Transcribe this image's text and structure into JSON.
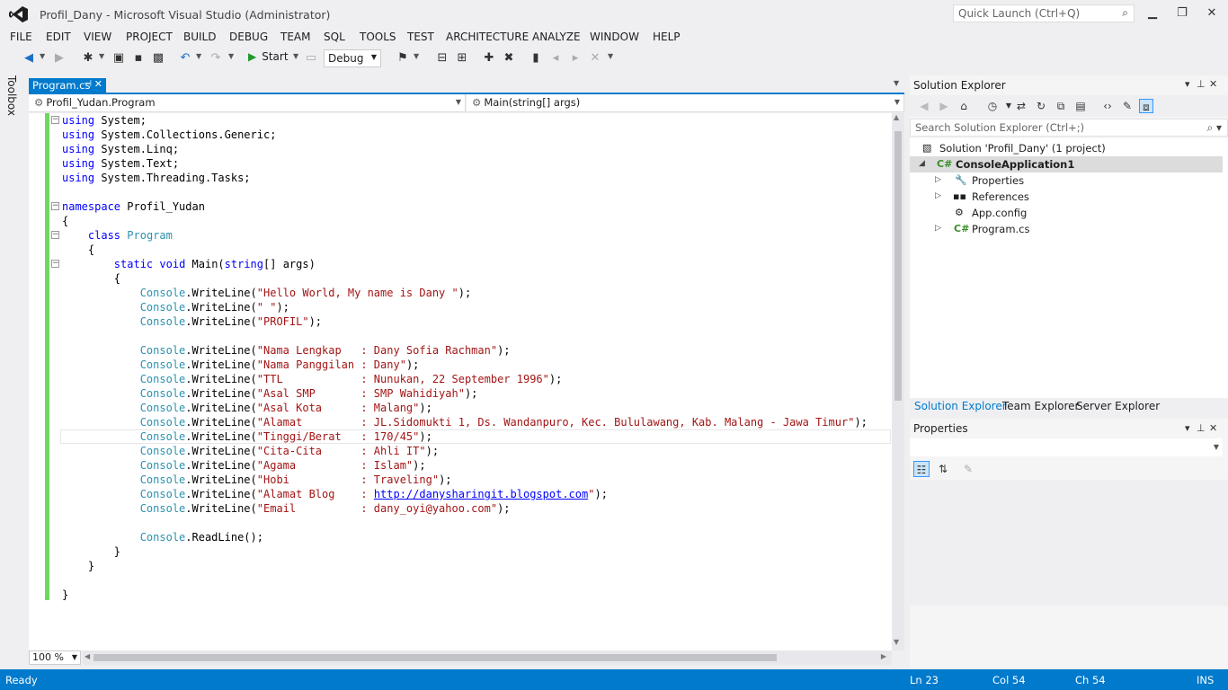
{
  "window": {
    "title": "Profil_Dany - Microsoft Visual Studio (Administrator)",
    "quick_launch_placeholder": "Quick Launch (Ctrl+Q)"
  },
  "menu": [
    "FILE",
    "EDIT",
    "VIEW",
    "PROJECT",
    "BUILD",
    "DEBUG",
    "TEAM",
    "SQL",
    "TOOLS",
    "TEST",
    "ARCHITECTURE",
    "ANALYZE",
    "WINDOW",
    "HELP"
  ],
  "toolbar": {
    "start_label": "Start",
    "configuration": "Debug"
  },
  "toolbox_label": "Toolbox",
  "editor": {
    "tab_label": "Program.cs",
    "nav_type": "Profil_Yudan.Program",
    "nav_member": "Main(string[] args)",
    "zoom": "100 %",
    "code": [
      [
        [
          "kw",
          "using"
        ],
        [
          "p",
          " System;"
        ]
      ],
      [
        [
          "kw",
          "using"
        ],
        [
          "p",
          " System.Collections.Generic;"
        ]
      ],
      [
        [
          "kw",
          "using"
        ],
        [
          "p",
          " System.Linq;"
        ]
      ],
      [
        [
          "kw",
          "using"
        ],
        [
          "p",
          " System.Text;"
        ]
      ],
      [
        [
          "kw",
          "using"
        ],
        [
          "p",
          " System.Threading.Tasks;"
        ]
      ],
      [],
      [
        [
          "kw",
          "namespace"
        ],
        [
          "p",
          " Profil_Yudan"
        ]
      ],
      [
        [
          "p",
          "{"
        ]
      ],
      [
        [
          "p",
          "    "
        ],
        [
          "kw",
          "class"
        ],
        [
          "p",
          " "
        ],
        [
          "ty",
          "Program"
        ]
      ],
      [
        [
          "p",
          "    {"
        ]
      ],
      [
        [
          "p",
          "        "
        ],
        [
          "kw",
          "static"
        ],
        [
          "p",
          " "
        ],
        [
          "kw",
          "void"
        ],
        [
          "p",
          " Main("
        ],
        [
          "kw",
          "string"
        ],
        [
          "p",
          "[] args)"
        ]
      ],
      [
        [
          "p",
          "        {"
        ]
      ],
      [
        [
          "p",
          "            "
        ],
        [
          "ty",
          "Console"
        ],
        [
          "p",
          ".WriteLine("
        ],
        [
          "st",
          "\"Hello World, My name is Dany \""
        ],
        [
          "p",
          ");"
        ]
      ],
      [
        [
          "p",
          "            "
        ],
        [
          "ty",
          "Console"
        ],
        [
          "p",
          ".WriteLine("
        ],
        [
          "st",
          "\" \""
        ],
        [
          "p",
          ");"
        ]
      ],
      [
        [
          "p",
          "            "
        ],
        [
          "ty",
          "Console"
        ],
        [
          "p",
          ".WriteLine("
        ],
        [
          "st",
          "\"PROFIL\""
        ],
        [
          "p",
          ");"
        ]
      ],
      [],
      [
        [
          "p",
          "            "
        ],
        [
          "ty",
          "Console"
        ],
        [
          "p",
          ".WriteLine("
        ],
        [
          "st",
          "\"Nama Lengkap   : Dany Sofia Rachman\""
        ],
        [
          "p",
          ");"
        ]
      ],
      [
        [
          "p",
          "            "
        ],
        [
          "ty",
          "Console"
        ],
        [
          "p",
          ".WriteLine("
        ],
        [
          "st",
          "\"Nama Panggilan : Dany\""
        ],
        [
          "p",
          ");"
        ]
      ],
      [
        [
          "p",
          "            "
        ],
        [
          "ty",
          "Console"
        ],
        [
          "p",
          ".WriteLine("
        ],
        [
          "st",
          "\"TTL            : Nunukan, 22 September 1996\""
        ],
        [
          "p",
          ");"
        ]
      ],
      [
        [
          "p",
          "            "
        ],
        [
          "ty",
          "Console"
        ],
        [
          "p",
          ".WriteLine("
        ],
        [
          "st",
          "\"Asal SMP       : SMP Wahidiyah\""
        ],
        [
          "p",
          ");"
        ]
      ],
      [
        [
          "p",
          "            "
        ],
        [
          "ty",
          "Console"
        ],
        [
          "p",
          ".WriteLine("
        ],
        [
          "st",
          "\"Asal Kota      : Malang\""
        ],
        [
          "p",
          ");"
        ]
      ],
      [
        [
          "p",
          "            "
        ],
        [
          "ty",
          "Console"
        ],
        [
          "p",
          ".WriteLine("
        ],
        [
          "st",
          "\"Alamat         : JL.Sidomukti 1, Ds. Wandanpuro, Kec. Bululawang, Kab. Malang - Jawa Timur\""
        ],
        [
          "p",
          ");"
        ]
      ],
      [
        [
          "p",
          "            "
        ],
        [
          "ty",
          "Console"
        ],
        [
          "p",
          ".WriteLine("
        ],
        [
          "st",
          "\"Tinggi/Berat   : 170/45\""
        ],
        [
          "p",
          ");"
        ]
      ],
      [
        [
          "p",
          "            "
        ],
        [
          "ty",
          "Console"
        ],
        [
          "p",
          ".WriteLine("
        ],
        [
          "st",
          "\"Cita-Cita      : Ahli IT\""
        ],
        [
          "p",
          ");"
        ]
      ],
      [
        [
          "p",
          "            "
        ],
        [
          "ty",
          "Console"
        ],
        [
          "p",
          ".WriteLine("
        ],
        [
          "st",
          "\"Agama          : Islam\""
        ],
        [
          "p",
          ");"
        ]
      ],
      [
        [
          "p",
          "            "
        ],
        [
          "ty",
          "Console"
        ],
        [
          "p",
          ".WriteLine("
        ],
        [
          "st",
          "\"Hobi           : Traveling\""
        ],
        [
          "p",
          ");"
        ]
      ],
      [
        [
          "p",
          "            "
        ],
        [
          "ty",
          "Console"
        ],
        [
          "p",
          ".WriteLine("
        ],
        [
          "st",
          "\"Alamat Blog    : "
        ],
        [
          "lk",
          "http://danysharingit.blogspot.com"
        ],
        [
          "st",
          "\""
        ],
        [
          "p",
          ");"
        ]
      ],
      [
        [
          "p",
          "            "
        ],
        [
          "ty",
          "Console"
        ],
        [
          "p",
          ".WriteLine("
        ],
        [
          "st",
          "\"Email          : dany_oyi@yahoo.com\""
        ],
        [
          "p",
          ");"
        ]
      ],
      [],
      [
        [
          "p",
          "            "
        ],
        [
          "ty",
          "Console"
        ],
        [
          "p",
          ".ReadLine();"
        ]
      ],
      [
        [
          "p",
          "        }"
        ]
      ],
      [
        [
          "p",
          "    }"
        ]
      ],
      [],
      [
        [
          "p",
          "}"
        ]
      ]
    ]
  },
  "solution_explorer": {
    "title": "Solution Explorer",
    "search_placeholder": "Search Solution Explorer (Ctrl+;)",
    "solution": "Solution 'Profil_Dany' (1 project)",
    "project": "ConsoleApplication1",
    "items": [
      "Properties",
      "References",
      "App.config",
      "Program.cs"
    ],
    "tabs": [
      "Solution Explorer",
      "Team Explorer",
      "Server Explorer"
    ]
  },
  "properties": {
    "title": "Properties"
  },
  "status": {
    "state": "Ready",
    "ln": "Ln 23",
    "col": "Col 54",
    "ch": "Ch 54",
    "mode": "INS"
  },
  "colors": {
    "accent": "#007acc",
    "keyword": "#0000ff",
    "type": "#2b91af",
    "string": "#a31515",
    "change_margin": "#6fd760"
  }
}
